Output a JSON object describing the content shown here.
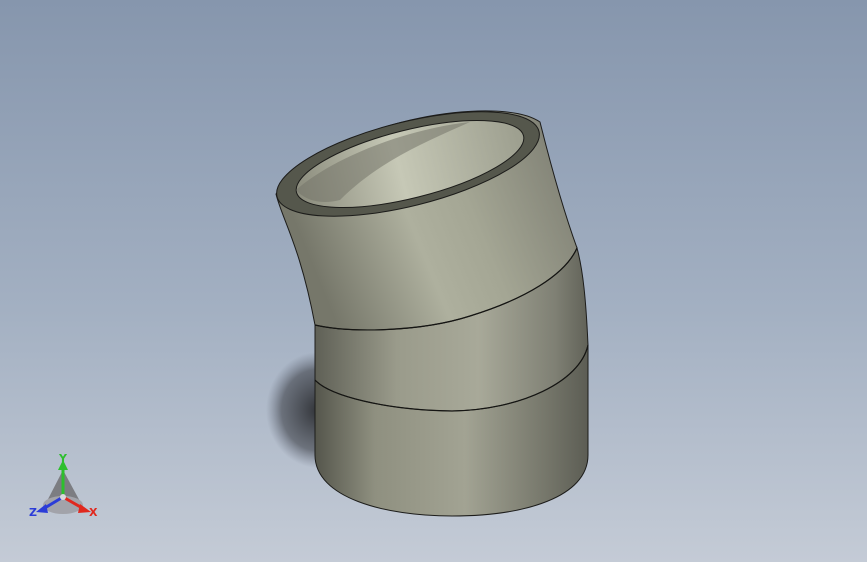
{
  "viewport": {
    "background_top": "#8696ad",
    "background_bottom": "#c4cbd6"
  },
  "model": {
    "name": "pipe-elbow",
    "segments": 3,
    "surface_color": "#a7a995",
    "shadow_color": "#2f3238"
  },
  "triad": {
    "x_label": "X",
    "y_label": "Y",
    "z_label": "Z",
    "x_color": "#e0281e",
    "y_color": "#2dbf2d",
    "z_color": "#2b3cd8"
  }
}
